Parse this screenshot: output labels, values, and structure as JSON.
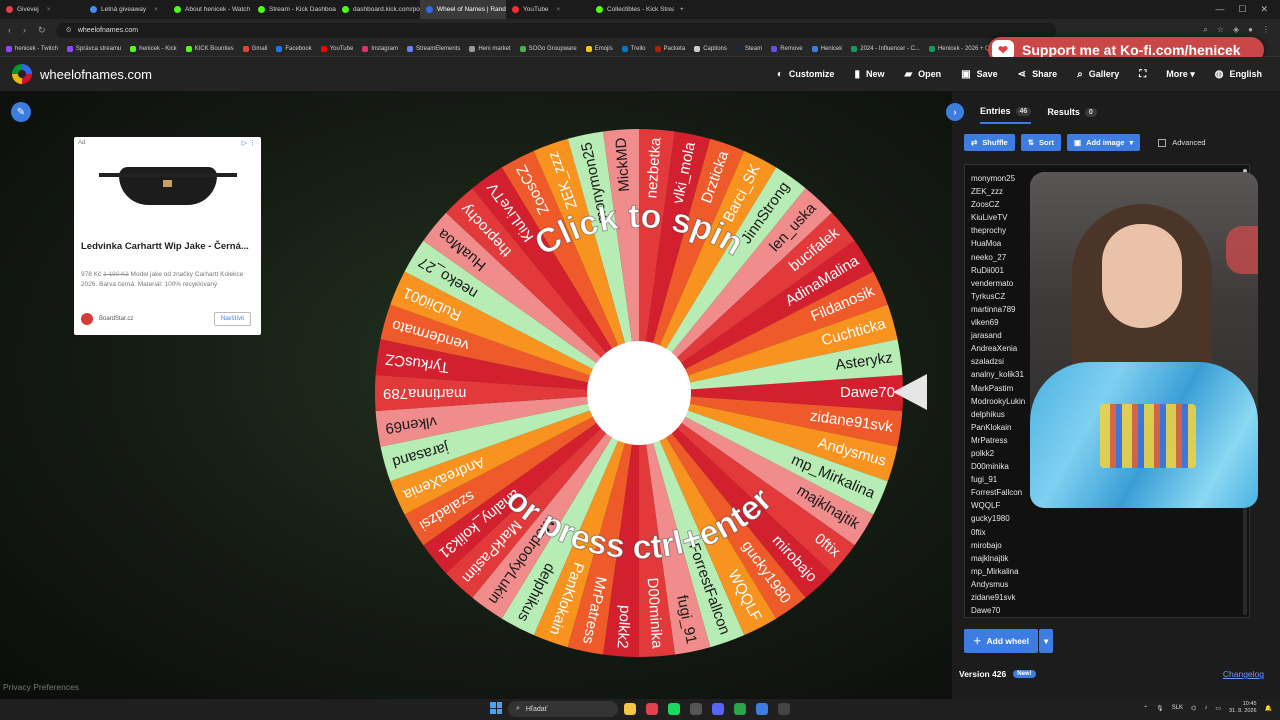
{
  "browser": {
    "tabs": [
      {
        "label": "Givevej",
        "color": "#e0414d",
        "active": false
      },
      {
        "label": "Letná giveaway",
        "color": "#4a8cf0",
        "active": false
      },
      {
        "label": "About henicek - Watch Li",
        "color": "#53fc18",
        "active": false
      },
      {
        "label": "Stream - Kick Dashboard",
        "color": "#53fc18",
        "active": false
      },
      {
        "label": "dashboard.kick.com/popo",
        "color": "#53fc18",
        "active": false
      },
      {
        "label": "Wheel of Names | Rando",
        "color": "#3369e8",
        "active": true
      },
      {
        "label": "YouTube",
        "color": "#ff2d2d",
        "active": false
      },
      {
        "label": "Collectibles - Kick Stream",
        "color": "#53fc18",
        "active": false
      }
    ],
    "url": "wheelofnames.com",
    "bookmarks": [
      {
        "label": "henicek - Twitch",
        "color": "#9146ff"
      },
      {
        "label": "Správca streamu",
        "color": "#9146ff"
      },
      {
        "label": "henicek - Kick",
        "color": "#53fc18"
      },
      {
        "label": "KICK Bounties",
        "color": "#53fc18"
      },
      {
        "label": "Gmail",
        "color": "#ea4335"
      },
      {
        "label": "Facebook",
        "color": "#1877f2"
      },
      {
        "label": "YouTube",
        "color": "#ff0000"
      },
      {
        "label": "Instagram",
        "color": "#e1306c"
      },
      {
        "label": "StreamElements",
        "color": "#6c7cff"
      },
      {
        "label": "Heni market",
        "color": "#999999"
      },
      {
        "label": "SOGo Groupware",
        "color": "#4caf50"
      },
      {
        "label": "Emojis",
        "color": "#f5c518"
      },
      {
        "label": "Trello",
        "color": "#0079bf"
      },
      {
        "label": "Packeta",
        "color": "#ba1b02"
      },
      {
        "label": "Captions",
        "color": "#cccccc"
      },
      {
        "label": "Steam",
        "color": "#1b2838"
      },
      {
        "label": "Remove",
        "color": "#6b4de6"
      },
      {
        "label": "Henicek",
        "color": "#3d7de0"
      },
      {
        "label": "2024 - Influencer - C...",
        "color": "#0f9d58"
      },
      {
        "label": "Henicek - 2026 + Q...",
        "color": "#0f9d58"
      },
      {
        "label": "Canva",
        "color": "#00c4cc"
      }
    ],
    "kofi": "Support me at Ko-fi.com/henicek"
  },
  "app": {
    "site": "wheelofnames.com",
    "menu": [
      {
        "icon": "palette-icon",
        "glyph": "◐",
        "label": "Customize"
      },
      {
        "icon": "new-file-icon",
        "glyph": "▮",
        "label": "New"
      },
      {
        "icon": "folder-icon",
        "glyph": "▰",
        "label": "Open"
      },
      {
        "icon": "save-icon",
        "glyph": "▣",
        "label": "Save"
      },
      {
        "icon": "share-icon",
        "glyph": "⋖",
        "label": "Share"
      },
      {
        "icon": "search-icon",
        "glyph": "⌕",
        "label": "Gallery"
      },
      {
        "icon": "fullscreen-icon",
        "glyph": "⛶",
        "label": ""
      },
      {
        "icon": "chevron-down-icon",
        "glyph": "",
        "label": "More ▾"
      },
      {
        "icon": "globe-icon",
        "glyph": "◍",
        "label": "English"
      }
    ]
  },
  "ad": {
    "label": "Ad",
    "title": "Ledvinka Carhartt Wip Jake - Černá...",
    "old_price": "1 190 Kč",
    "price": "978 Kč",
    "desc": "Model jake od značky Carhartt Kolekce 2026. Barva černá. Materiál: 100% recyklovaný",
    "brand": "BoardStar.cz",
    "cta": "Navštívit"
  },
  "wheel": {
    "top_text": "Click to spin",
    "bottom_text": "or press ctrl+enter",
    "colors": [
      "#d2202e",
      "#ef5a2a",
      "#f7931e",
      "#b7ecb4",
      "#f08c8c",
      "#e23a3a"
    ]
  },
  "panel": {
    "tab_entries": "Entries",
    "entries_count": "46",
    "tab_results": "Results",
    "results_count": "0",
    "shuffle": "Shuffle",
    "sort": "Sort",
    "add_image": "Add image",
    "advanced": "Advanced",
    "entries": [
      "Dawe70",
      "zidane91svk",
      "Andysmus",
      "mp_Mirkalina",
      "majklnajtik",
      "0ftix",
      "mirobajo",
      "gucky1980",
      "WQQLF",
      "ForrestFallcon",
      "fugi_91",
      "D00minika",
      "polkk2",
      "MrPatress",
      "PanKlokain",
      "delphikus",
      "ModrookyLukin",
      "MarkPastim",
      "analny_kolik31",
      "szaladzsi",
      "AndreaXenia",
      "jarasand",
      "vlken69",
      "martinna789",
      "TyrkusCZ",
      "vendermato",
      "RuDii001",
      "neeko_27",
      "HuaMoa",
      "theprochy",
      "KiuLiveTV",
      "ZoosCZ",
      "ZEK_zzz",
      "monymon25",
      "MickMD",
      "nezbetka",
      "vlki_mola",
      "Drzticka",
      "Barci_SK",
      "JinnStrong",
      "len_uska",
      "bucifalek",
      "AdinaMalina",
      "Fildanosik",
      "Cuchticka",
      "Asterykz"
    ],
    "visible_entries": [
      "monymon25",
      "ZEK_zzz",
      "ZoosCZ",
      "KiuLiveTV",
      "theprochy",
      "HuaMoa",
      "neeko_27",
      "RuDii001",
      "vendermato",
      "TyrkusCZ",
      "martinna789",
      "vlken69",
      "jarasand",
      "AndreaXenia",
      "szaladzsi",
      "analny_kolik31",
      "MarkPastim",
      "ModrookyLukin",
      "delphikus",
      "PanKlokain",
      "MrPatress",
      "polkk2",
      "D00minika",
      "fugi_91",
      "ForrestFallcon",
      "WQQLF",
      "gucky1980",
      "0ftix",
      "mirobajo",
      "majklnajtik",
      "mp_Mirkalina",
      "Andysmus",
      "zidane91svk",
      "Dawe70"
    ],
    "add_wheel": "Add wheel",
    "version": "Version 426",
    "new_badge": "New!",
    "changelog": "Changelog"
  },
  "privacy": "Privacy Preferences",
  "taskbar": {
    "search": "Hľadať",
    "lang": "SLK",
    "time": "10:45",
    "date": "31. 8. 2026"
  }
}
